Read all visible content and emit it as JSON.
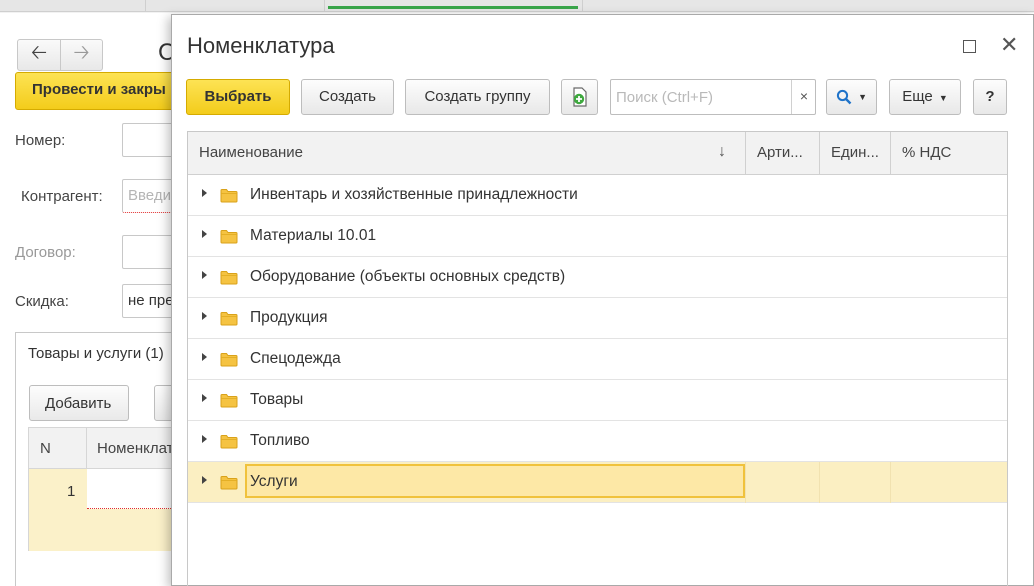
{
  "background_doc": {
    "title_fragment": "С",
    "post_button": "Провести и закры",
    "labels": {
      "number": "Номер:",
      "counterparty": "Контрагент:",
      "contract": "Договор:",
      "discount": "Скидка:"
    },
    "counterparty_placeholder": "Введи",
    "discount_value": "не пре",
    "tab_label": "Товары и услуги (1)",
    "add_button": "Добавить",
    "grid": {
      "col_n": "N",
      "col_nomenclature": "Номенклат",
      "row_number": "1"
    }
  },
  "dialog": {
    "title": "Номенклатура",
    "toolbar": {
      "select": "Выбрать",
      "create": "Создать",
      "create_group": "Создать группу",
      "search_placeholder": "Поиск (Ctrl+F)",
      "search_clear": "×",
      "more": "Еще",
      "help": "?"
    },
    "columns": [
      "Наименование",
      "Арти...",
      "Един...",
      "% НДС"
    ],
    "sort_indicator": "↓",
    "rows": [
      {
        "name": "Инвентарь и хозяйственные принадлежности"
      },
      {
        "name": "Материалы 10.01"
      },
      {
        "name": "Оборудование (объекты основных средств)"
      },
      {
        "name": "Продукция"
      },
      {
        "name": "Спецодежда"
      },
      {
        "name": "Товары"
      },
      {
        "name": "Топливо"
      },
      {
        "name": "Услуги",
        "selected": true
      }
    ]
  },
  "colors": {
    "accent_yellow": "#f5d22a",
    "selection_row": "#fbefc2",
    "folder": "#f5c342"
  }
}
